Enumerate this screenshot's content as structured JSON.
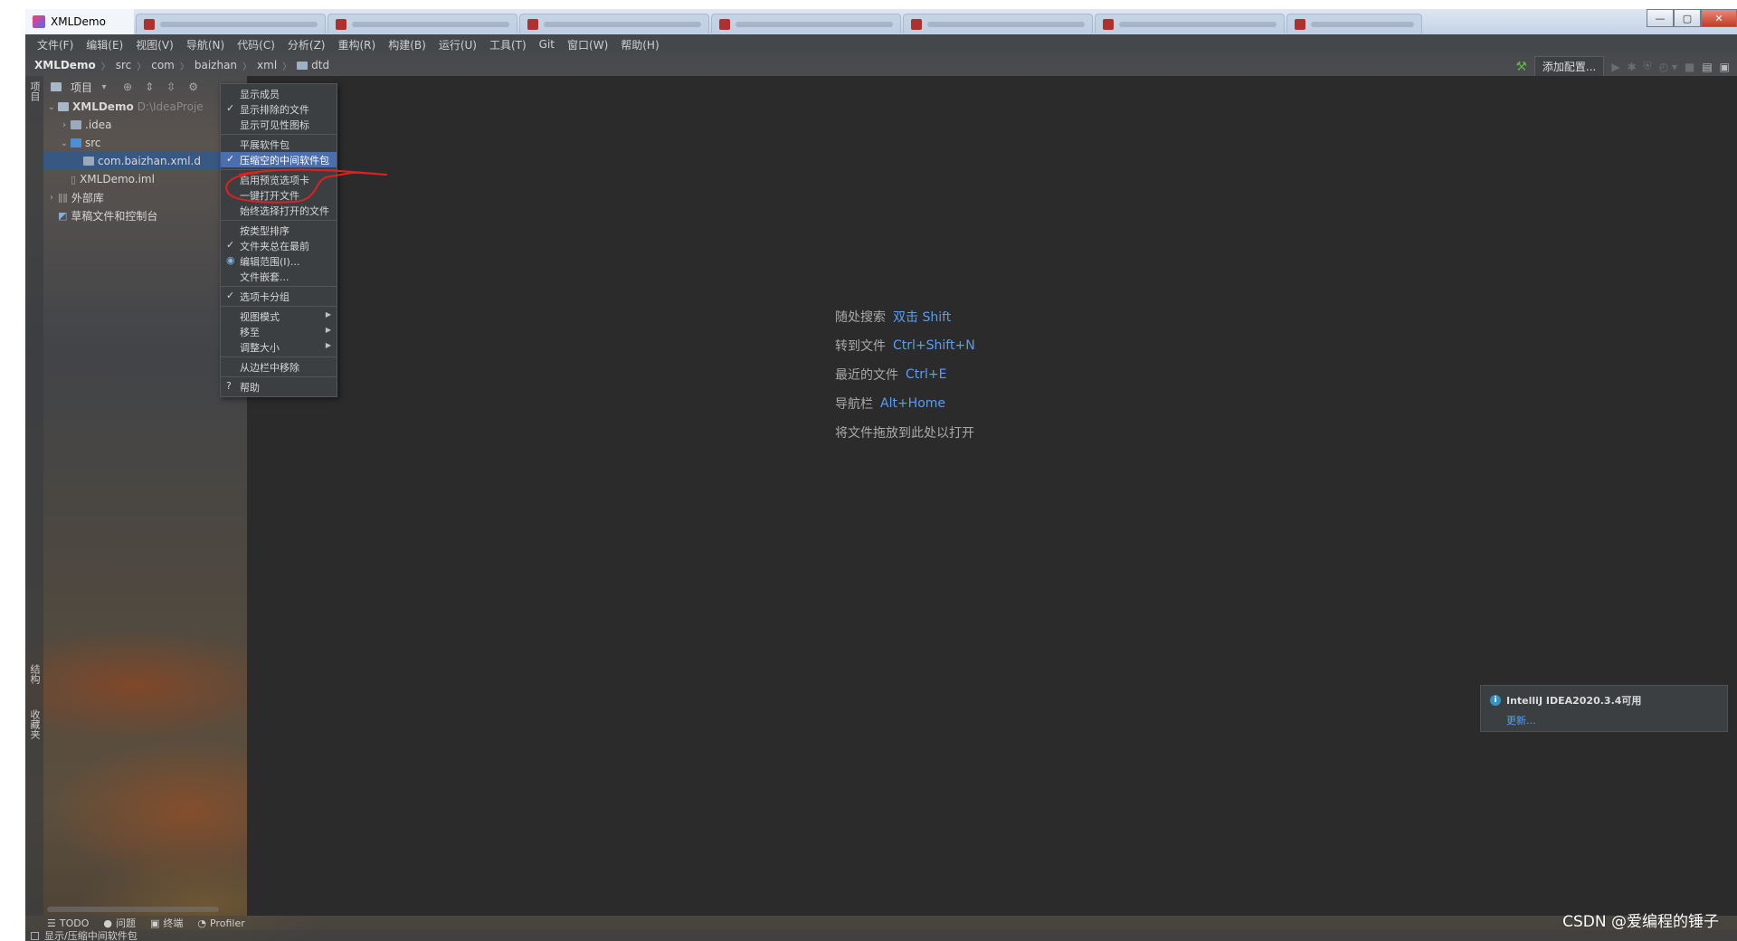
{
  "window": {
    "title": "XMLDemo",
    "tabs": [
      "",
      "",
      "",
      "",
      "",
      "",
      "",
      ""
    ]
  },
  "menubar": [
    "文件(F)",
    "编辑(E)",
    "视图(V)",
    "导航(N)",
    "代码(C)",
    "分析(Z)",
    "重构(R)",
    "构建(B)",
    "运行(U)",
    "工具(T)",
    "Git",
    "窗口(W)",
    "帮助(H)"
  ],
  "breadcrumb": [
    "XMLDemo",
    "src",
    "com",
    "baizhan",
    "xml",
    "dtd"
  ],
  "toolbar": {
    "add_config_label": "添加配置..."
  },
  "left_stripe": {
    "project_label": "项目",
    "structure_label": "结构",
    "favorites_label": "收藏夹"
  },
  "project_panel": {
    "header_label": "项目",
    "tree": {
      "root": {
        "name": "XMLDemo",
        "path": "D:\\IdeaProje"
      },
      "idea": ".idea",
      "src": "src",
      "package": "com.baizhan.xml.d",
      "iml": "XMLDemo.iml",
      "external_libs": "外部库",
      "scratches": "草稿文件和控制台"
    }
  },
  "context_menu": {
    "items": [
      {
        "label": "显示成员",
        "mark": ""
      },
      {
        "label": "显示排除的文件",
        "mark": "✓"
      },
      {
        "label": "显示可见性图标",
        "mark": ""
      },
      {
        "label": "平展软件包",
        "mark": ""
      },
      {
        "label": "压缩空的中间软件包",
        "mark": "✓"
      },
      {
        "label": "启用预览选项卡",
        "mark": ""
      },
      {
        "label": "一键打开文件",
        "mark": ""
      },
      {
        "label": "始终选择打开的文件",
        "mark": ""
      },
      {
        "label": "按类型排序",
        "mark": ""
      },
      {
        "label": "文件夹总在最前",
        "mark": "✓"
      },
      {
        "label": "编辑范围(I)...",
        "mark": "◉"
      },
      {
        "label": "文件嵌套...",
        "mark": ""
      },
      {
        "label": "选项卡分组",
        "mark": "✓"
      },
      {
        "label": "视图模式",
        "mark": ""
      },
      {
        "label": "移至",
        "mark": ""
      },
      {
        "label": "调整大小",
        "mark": ""
      },
      {
        "label": "从边栏中移除",
        "mark": ""
      },
      {
        "label": "帮助",
        "mark": "?"
      }
    ]
  },
  "editor_hints": [
    {
      "label": "随处搜索",
      "shortcut": "双击 Shift"
    },
    {
      "label": "转到文件",
      "shortcut": "Ctrl+Shift+N"
    },
    {
      "label": "最近的文件",
      "shortcut": "Ctrl+E"
    },
    {
      "label": "导航栏",
      "shortcut": "Alt+Home"
    },
    {
      "label": "将文件拖放到此处以打开",
      "shortcut": ""
    }
  ],
  "notification": {
    "title": "IntelliJ IDEA2020.3.4可用",
    "link": "更新..."
  },
  "bottom_tools": [
    "TODO",
    "问题",
    "终端",
    "Profiler"
  ],
  "status_text": "显示/压缩中间软件包",
  "watermark": "CSDN @爱编程的锤子",
  "colors": {
    "accent": "#589df6",
    "menu_highlight": "#4b6eaf",
    "annotation": "#e02020"
  }
}
